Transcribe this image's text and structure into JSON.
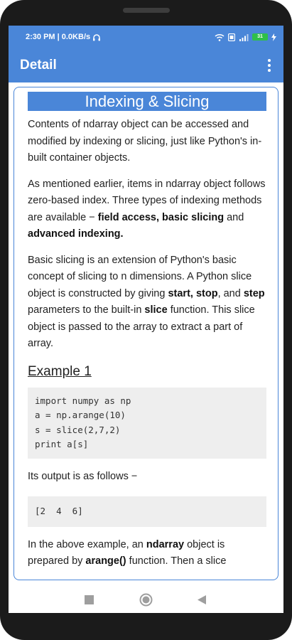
{
  "status_bar": {
    "time": "2:30 PM | 0.0KB/s",
    "battery": "31"
  },
  "app_bar": {
    "title": "Detail"
  },
  "content": {
    "heading": "Indexing & Slicing",
    "para1": "Contents of ndarray object can be accessed and modified by indexing or slicing, just like Python's in-built container objects.",
    "para2": {
      "text1": "As mentioned earlier, items in ndarray object follows zero-based index. Three types of indexing methods are available − ",
      "bold1": "field access, basic slicing",
      "text2": " and ",
      "bold2": "advanced indexing."
    },
    "para3": {
      "text1": "Basic slicing is an extension of Python's basic concept of slicing to n dimensions. A Python slice object is constructed by giving ",
      "bold1": "start, stop",
      "text2": ", and ",
      "bold2": "step",
      "text3": " parameters to the built-in ",
      "bold3": "slice",
      "text4": " function. This slice object is passed to the array to extract a part of array."
    },
    "example_title": "Example 1",
    "code_lines": [
      "import numpy as np",
      "a = np.arange(10)",
      "s = slice(2,7,2)",
      "print a[s]"
    ],
    "output_intro": "Its output is as follows −",
    "output": "[2  4  6]",
    "para4": {
      "text1": "In the above example, an ",
      "bold1": "ndarray",
      "text2": " object is prepared by ",
      "bold2": "arange()",
      "text3": " function. Then a slice"
    }
  },
  "colors": {
    "accent": "#4a86d8",
    "code_bg": "#eeeeee",
    "battery": "#2fbf4a"
  }
}
